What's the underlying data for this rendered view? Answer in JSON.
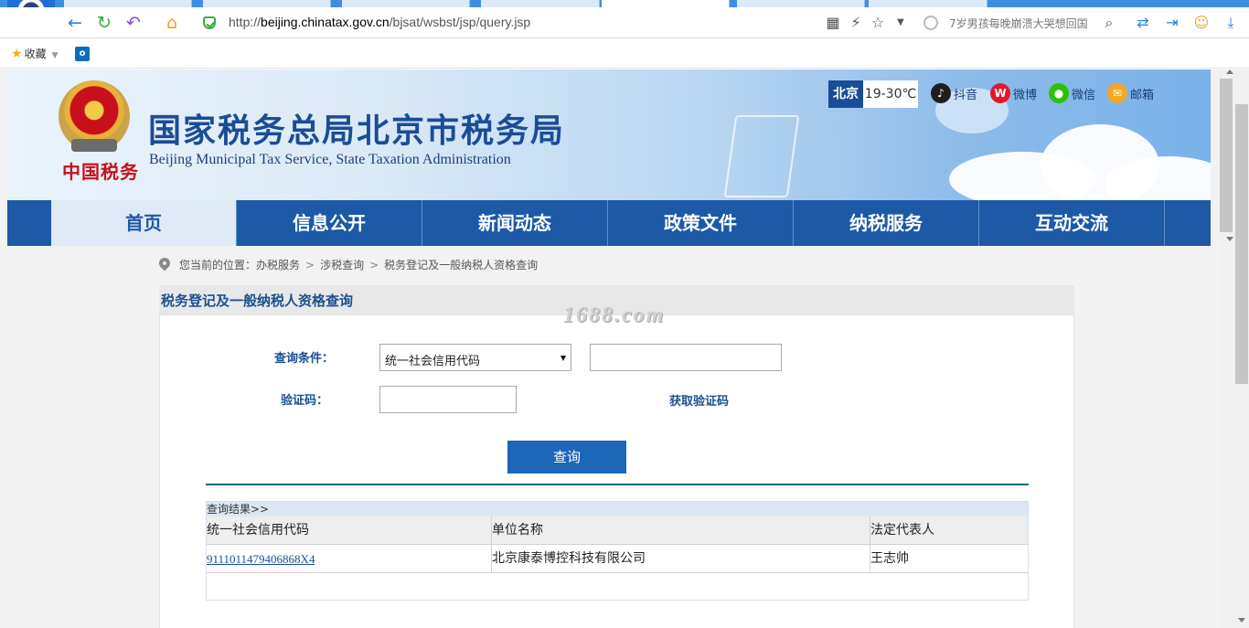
{
  "browser": {
    "url_prefix": "http://",
    "url_host": "beijing.chinatax.gov.cn",
    "url_path": "/bjsat/wsbst/jsp/query.jsp",
    "search_text": "7岁男孩每晚崩溃大哭想回国",
    "bookmarks_label": "收藏",
    "outlook_label": "o"
  },
  "site": {
    "title": "国家税务总局北京市税务局",
    "subtitle": "Beijing Municipal Tax Service, State Taxation Administration",
    "seal_text": "中国税务",
    "weather_city": "北京",
    "weather_temp": "19-30℃",
    "social": [
      {
        "label": "抖音",
        "color": "#1e1e1e",
        "glyph": "♪"
      },
      {
        "label": "微博",
        "color": "#e6162d",
        "glyph": "W"
      },
      {
        "label": "微信",
        "color": "#2dc100",
        "glyph": "●"
      },
      {
        "label": "邮箱",
        "color": "#f5a623",
        "glyph": "✉"
      }
    ]
  },
  "nav": {
    "items": [
      "首页",
      "信息公开",
      "新闻动态",
      "政策文件",
      "纳税服务",
      "互动交流"
    ]
  },
  "breadcrumb": {
    "prefix": "您当前的位置：",
    "items": [
      "办税服务",
      "涉税查询",
      "税务登记及一般纳税人资格查询"
    ],
    "separator": ">"
  },
  "panel": {
    "title": "税务登记及一般纳税人资格查询"
  },
  "watermark": "1688.com",
  "form": {
    "condition_label": "查询条件：",
    "condition_value": "统一社会信用代码",
    "condition_input_value": "",
    "captcha_label": "验证码：",
    "captcha_input_value": "",
    "captcha_link": "获取验证码",
    "query_button": "查询"
  },
  "results": {
    "title": "查询结果>>",
    "columns": [
      "统一社会信用代码",
      "单位名称",
      "法定代表人"
    ],
    "rows": [
      [
        "91110114794068​68X4",
        "北京康泰博控科技有限公司",
        "王志帅"
      ]
    ]
  }
}
